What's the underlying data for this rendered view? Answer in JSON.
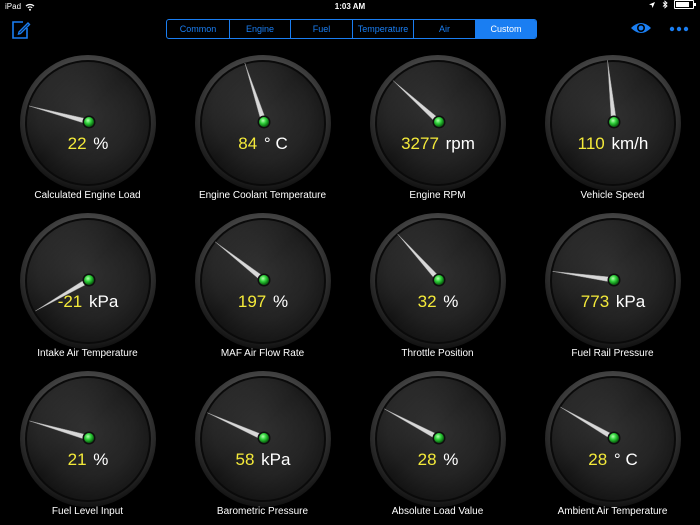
{
  "status_bar": {
    "device": "iPad",
    "time": "1:03 AM",
    "battery_level": 0.9
  },
  "toolbar": {
    "tabs": [
      {
        "label": "Common",
        "active": false
      },
      {
        "label": "Engine",
        "active": false
      },
      {
        "label": "Fuel",
        "active": false
      },
      {
        "label": "Temperature",
        "active": false
      },
      {
        "label": "Air",
        "active": false
      },
      {
        "label": "Custom",
        "active": true
      }
    ],
    "accent_color": "#1a7ef2"
  },
  "gauges": [
    {
      "label": "Calculated Engine Load",
      "value": "22",
      "unit": "%",
      "needle_angle": -75
    },
    {
      "label": "Engine Coolant Temperature",
      "value": "84",
      "unit": "° C",
      "needle_angle": -18
    },
    {
      "label": "Engine RPM",
      "value": "3277",
      "unit": "rpm",
      "needle_angle": -48
    },
    {
      "label": "Vehicle Speed",
      "value": "110",
      "unit": "km/h",
      "needle_angle": -6
    },
    {
      "label": "Intake Air Temperature",
      "value": "-21",
      "unit": "kPa",
      "needle_angle": -120
    },
    {
      "label": "MAF Air Flow Rate",
      "value": "197",
      "unit": "%",
      "needle_angle": -52
    },
    {
      "label": "Throttle Position",
      "value": "32",
      "unit": "%",
      "needle_angle": -42
    },
    {
      "label": "Fuel Rail Pressure",
      "value": "773",
      "unit": "kPa",
      "needle_angle": -82
    },
    {
      "label": "Fuel Level Input",
      "value": "21",
      "unit": "%",
      "needle_angle": -74
    },
    {
      "label": "Barometric Pressure",
      "value": "58",
      "unit": "kPa",
      "needle_angle": -66
    },
    {
      "label": "Absolute Load Value",
      "value": "28",
      "unit": "%",
      "needle_angle": -62
    },
    {
      "label": "Ambient Air Temperature",
      "value": "28",
      "unit": "° C",
      "needle_angle": -60
    }
  ],
  "colors": {
    "value_text": "#f4ea3a",
    "hub_green": "#2fd23a"
  }
}
